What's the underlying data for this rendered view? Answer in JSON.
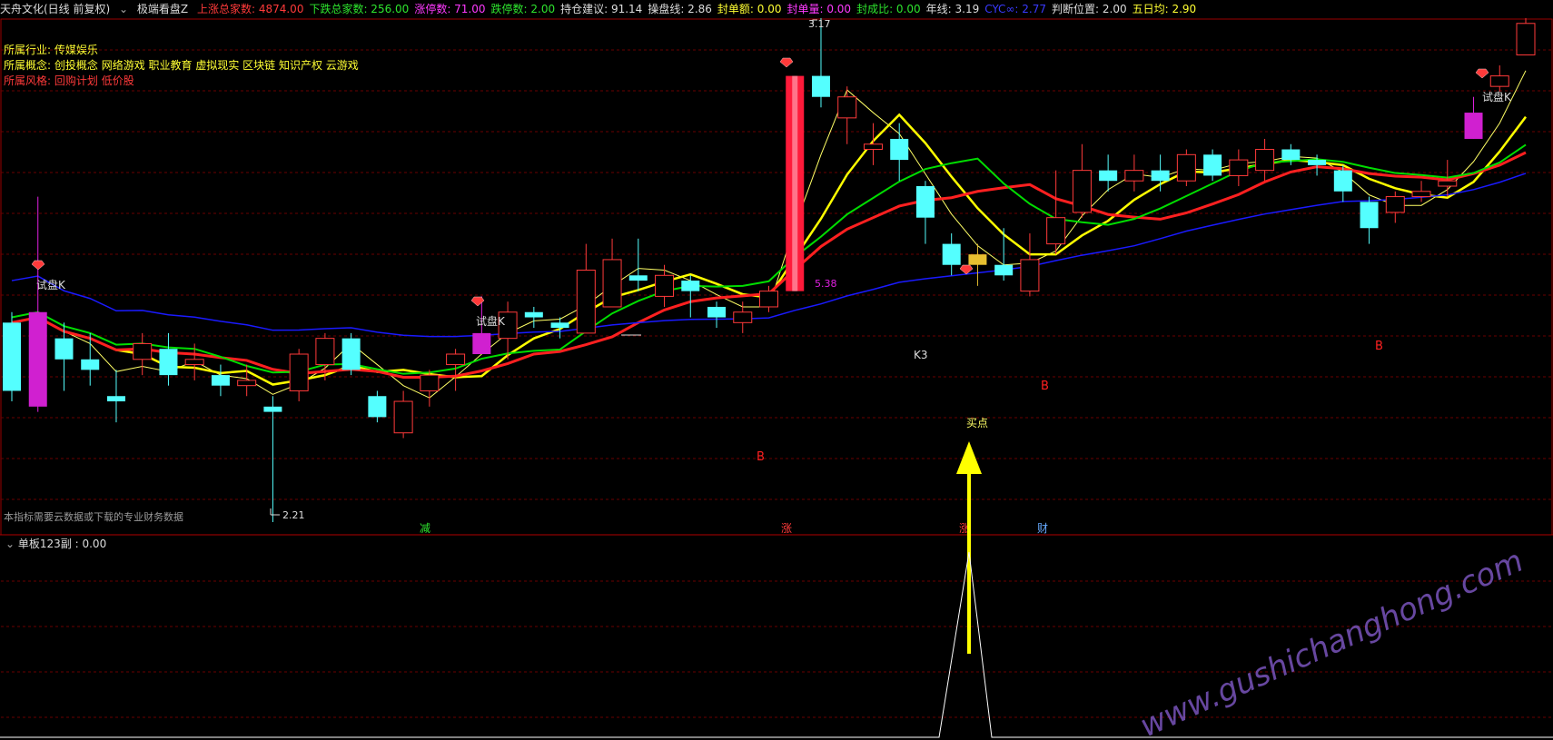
{
  "topbar": {
    "stock_name": "天舟文化(日线 前复权)",
    "indicator_name": "极端看盘Z",
    "items": [
      {
        "label": "上涨总家数:",
        "value": "4874.00",
        "color": "#ff3a3a"
      },
      {
        "label": "下跌总家数:",
        "value": "256.00",
        "color": "#2ee52e"
      },
      {
        "label": "涨停数:",
        "value": "71.00",
        "color": "#ff3aff"
      },
      {
        "label": "跌停数:",
        "value": "2.00",
        "color": "#2ee52e"
      },
      {
        "label": "持仓建议:",
        "value": "91.14",
        "color": "#dddddd"
      },
      {
        "label": "操盘线:",
        "value": "2.86",
        "color": "#dddddd"
      },
      {
        "label": "封单额:",
        "value": "0.00",
        "color": "#ffff33"
      },
      {
        "label": "封单量:",
        "value": "0.00",
        "color": "#ff3aff"
      },
      {
        "label": "封成比:",
        "value": "0.00",
        "color": "#2ee52e"
      },
      {
        "label": "年线:",
        "value": "3.19",
        "color": "#dddddd"
      },
      {
        "label": "CYC∞:",
        "value": "2.77",
        "color": "#3a3aff"
      },
      {
        "label": "判断位置:",
        "value": "2.00",
        "color": "#dddddd"
      },
      {
        "label": "五日均:",
        "value": "2.90",
        "color": "#ffff33"
      }
    ]
  },
  "info": {
    "industry_label": "所属行业:",
    "industry_value": "传媒娱乐",
    "concept_label": "所属概念:",
    "concept_value": "创投概念 网络游戏 职业教育 虚拟现实 区块链 知识产权 云游戏",
    "style_label": "所属风格:",
    "style_value": "回购计划 低价股"
  },
  "note": "本指标需要云数据或下载的专业财务数据",
  "subpanel": {
    "title": "单板123副",
    "value": ": 0.00"
  },
  "watermark": "www.gushichanghong.com",
  "annotations": {
    "test_k": "试盘K",
    "k3": "K3",
    "buy_point": "买点",
    "b": "B",
    "val_538": "5.38",
    "max_price": "3.17",
    "min_price": "2.21",
    "bottom_marks": [
      "减",
      "涨",
      "涨",
      "财"
    ]
  },
  "colors": {
    "up": "#ff3a3a",
    "down": "#54ffff",
    "yellow": "#ffff00",
    "green": "#00e000",
    "blue": "#1a1aff",
    "red_line": "#ff2020",
    "magenta": "#e020e0",
    "grid": "#7a0000"
  },
  "chart_data": {
    "type": "candlestick",
    "title": "",
    "y_range": [
      2.21,
      3.17
    ],
    "candles": [
      {
        "o": 2.46,
        "c": 2.59,
        "h": 2.61,
        "l": 2.44,
        "dir": "down"
      },
      {
        "o": 2.43,
        "c": 2.61,
        "h": 2.83,
        "l": 2.42,
        "dir": "magenta"
      },
      {
        "o": 2.56,
        "c": 2.52,
        "h": 2.59,
        "l": 2.46,
        "dir": "down"
      },
      {
        "o": 2.5,
        "c": 2.52,
        "h": 2.57,
        "l": 2.47,
        "dir": "down"
      },
      {
        "o": 2.44,
        "c": 2.45,
        "h": 2.5,
        "l": 2.4,
        "dir": "down"
      },
      {
        "o": 2.52,
        "c": 2.55,
        "h": 2.57,
        "l": 2.49,
        "dir": "up"
      },
      {
        "o": 2.54,
        "c": 2.49,
        "h": 2.57,
        "l": 2.47,
        "dir": "down"
      },
      {
        "o": 2.52,
        "c": 2.51,
        "h": 2.55,
        "l": 2.48,
        "dir": "up"
      },
      {
        "o": 2.49,
        "c": 2.47,
        "h": 2.51,
        "l": 2.45,
        "dir": "down"
      },
      {
        "o": 2.48,
        "c": 2.47,
        "h": 2.51,
        "l": 2.45,
        "dir": "up"
      },
      {
        "o": 2.43,
        "c": 2.42,
        "h": 2.45,
        "l": 2.21,
        "dir": "down"
      },
      {
        "o": 2.46,
        "c": 2.53,
        "h": 2.54,
        "l": 2.44,
        "dir": "up"
      },
      {
        "o": 2.51,
        "c": 2.56,
        "h": 2.57,
        "l": 2.48,
        "dir": "up"
      },
      {
        "o": 2.5,
        "c": 2.56,
        "h": 2.57,
        "l": 2.49,
        "dir": "down"
      },
      {
        "o": 2.45,
        "c": 2.41,
        "h": 2.46,
        "l": 2.4,
        "dir": "down"
      },
      {
        "o": 2.38,
        "c": 2.44,
        "h": 2.46,
        "l": 2.37,
        "dir": "up"
      },
      {
        "o": 2.46,
        "c": 2.49,
        "h": 2.5,
        "l": 2.43,
        "dir": "up"
      },
      {
        "o": 2.51,
        "c": 2.53,
        "h": 2.54,
        "l": 2.46,
        "dir": "up"
      },
      {
        "o": 2.53,
        "c": 2.57,
        "h": 2.64,
        "l": 2.53,
        "dir": "magenta"
      },
      {
        "o": 2.56,
        "c": 2.61,
        "h": 2.63,
        "l": 2.52,
        "dir": "up"
      },
      {
        "o": 2.61,
        "c": 2.6,
        "h": 2.62,
        "l": 2.58,
        "dir": "down"
      },
      {
        "o": 2.59,
        "c": 2.58,
        "h": 2.6,
        "l": 2.56,
        "dir": "down"
      },
      {
        "o": 2.57,
        "c": 2.69,
        "h": 2.74,
        "l": 2.57,
        "dir": "up"
      },
      {
        "o": 2.62,
        "c": 2.71,
        "h": 2.75,
        "l": 2.62,
        "dir": "up"
      },
      {
        "o": 2.67,
        "c": 2.68,
        "h": 2.75,
        "l": 2.65,
        "dir": "down"
      },
      {
        "o": 2.64,
        "c": 2.68,
        "h": 2.7,
        "l": 2.62,
        "dir": "up"
      },
      {
        "o": 2.67,
        "c": 2.65,
        "h": 2.68,
        "l": 2.6,
        "dir": "down"
      },
      {
        "o": 2.62,
        "c": 2.6,
        "h": 2.63,
        "l": 2.58,
        "dir": "down"
      },
      {
        "o": 2.59,
        "c": 2.61,
        "h": 2.63,
        "l": 2.57,
        "dir": "up"
      },
      {
        "o": 2.62,
        "c": 2.65,
        "h": 2.66,
        "l": 2.61,
        "dir": "up"
      },
      {
        "o": 2.65,
        "c": 3.06,
        "h": 3.06,
        "l": 2.65,
        "dir": "red_big"
      },
      {
        "o": 3.06,
        "c": 3.02,
        "h": 3.17,
        "l": 3.0,
        "dir": "down"
      },
      {
        "o": 2.98,
        "c": 3.02,
        "h": 3.04,
        "l": 2.93,
        "dir": "up"
      },
      {
        "o": 2.92,
        "c": 2.93,
        "h": 2.97,
        "l": 2.89,
        "dir": "up"
      },
      {
        "o": 2.94,
        "c": 2.9,
        "h": 2.97,
        "l": 2.86,
        "dir": "down"
      },
      {
        "o": 2.85,
        "c": 2.79,
        "h": 2.86,
        "l": 2.74,
        "dir": "down"
      },
      {
        "o": 2.74,
        "c": 2.7,
        "h": 2.76,
        "l": 2.68,
        "dir": "down"
      },
      {
        "o": 2.7,
        "c": 2.72,
        "h": 2.74,
        "l": 2.66,
        "dir": "gold"
      },
      {
        "o": 2.7,
        "c": 2.68,
        "h": 2.77,
        "l": 2.67,
        "dir": "down"
      },
      {
        "o": 2.65,
        "c": 2.71,
        "h": 2.76,
        "l": 2.64,
        "dir": "up"
      },
      {
        "o": 2.74,
        "c": 2.79,
        "h": 2.88,
        "l": 2.72,
        "dir": "up"
      },
      {
        "o": 2.8,
        "c": 2.88,
        "h": 2.93,
        "l": 2.79,
        "dir": "up"
      },
      {
        "o": 2.88,
        "c": 2.86,
        "h": 2.91,
        "l": 2.84,
        "dir": "down"
      },
      {
        "o": 2.86,
        "c": 2.88,
        "h": 2.91,
        "l": 2.84,
        "dir": "up"
      },
      {
        "o": 2.88,
        "c": 2.86,
        "h": 2.91,
        "l": 2.84,
        "dir": "down"
      },
      {
        "o": 2.86,
        "c": 2.91,
        "h": 2.92,
        "l": 2.85,
        "dir": "up"
      },
      {
        "o": 2.91,
        "c": 2.87,
        "h": 2.92,
        "l": 2.86,
        "dir": "down"
      },
      {
        "o": 2.87,
        "c": 2.9,
        "h": 2.92,
        "l": 2.85,
        "dir": "up"
      },
      {
        "o": 2.88,
        "c": 2.92,
        "h": 2.94,
        "l": 2.86,
        "dir": "up"
      },
      {
        "o": 2.92,
        "c": 2.9,
        "h": 2.93,
        "l": 2.89,
        "dir": "down"
      },
      {
        "o": 2.9,
        "c": 2.89,
        "h": 2.91,
        "l": 2.87,
        "dir": "down"
      },
      {
        "o": 2.88,
        "c": 2.84,
        "h": 2.89,
        "l": 2.82,
        "dir": "down"
      },
      {
        "o": 2.82,
        "c": 2.77,
        "h": 2.83,
        "l": 2.74,
        "dir": "down"
      },
      {
        "o": 2.8,
        "c": 2.83,
        "h": 2.84,
        "l": 2.78,
        "dir": "up"
      },
      {
        "o": 2.83,
        "c": 2.84,
        "h": 2.86,
        "l": 2.82,
        "dir": "up"
      },
      {
        "o": 2.85,
        "c": 2.86,
        "h": 2.9,
        "l": 2.83,
        "dir": "up"
      },
      {
        "o": 2.94,
        "c": 2.99,
        "h": 3.02,
        "l": 2.94,
        "dir": "magenta"
      },
      {
        "o": 3.04,
        "c": 3.06,
        "h": 3.08,
        "l": 3.03,
        "dir": "up"
      },
      {
        "o": 3.1,
        "c": 3.16,
        "h": 3.17,
        "l": 3.1,
        "dir": "up"
      }
    ]
  }
}
